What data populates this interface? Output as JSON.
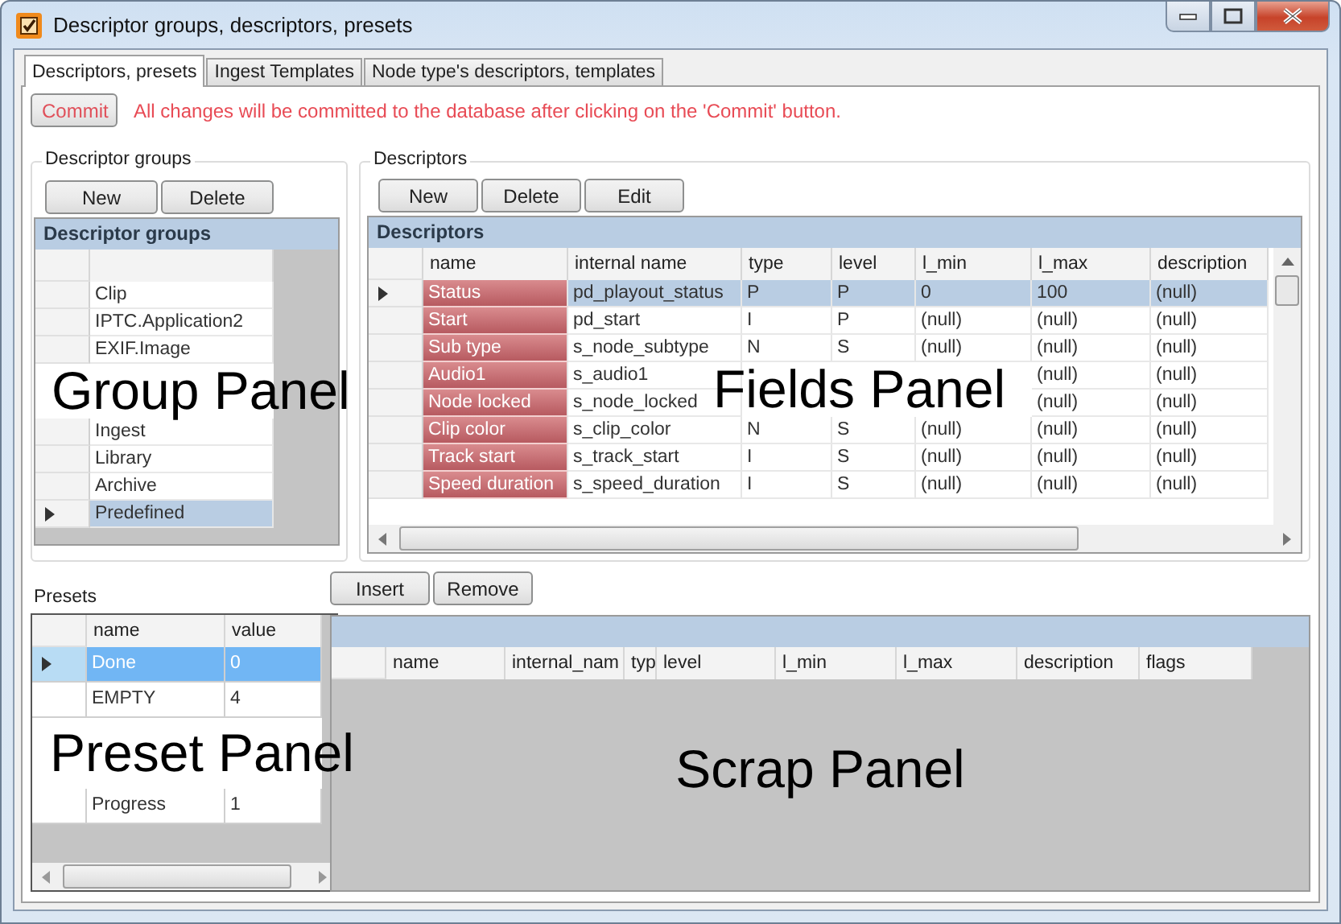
{
  "window": {
    "title": "Descriptor groups, descriptors, presets"
  },
  "tabs": [
    {
      "label": "Descriptors, presets",
      "selected": true
    },
    {
      "label": "Ingest Templates",
      "selected": false
    },
    {
      "label": "Node type's descriptors, templates",
      "selected": false
    }
  ],
  "commit_button": "Commit",
  "commit_note": "All changes will be committed to the database after clicking on the 'Commit' button.",
  "descriptor_groups": {
    "legend": "Descriptor groups",
    "buttons": [
      "New",
      "Delete"
    ],
    "grid_title": "Descriptor groups",
    "items": [
      {
        "name": "Clip",
        "selected": false
      },
      {
        "name": "IPTC.Application2",
        "selected": false
      },
      {
        "name": "EXIF.Image",
        "selected": false
      },
      {
        "selected": false
      },
      {
        "name": "Ingest",
        "selected": false
      },
      {
        "name": "Library",
        "selected": false
      },
      {
        "name": "Archive",
        "selected": false
      },
      {
        "name": "Predefined",
        "selected": true
      }
    ]
  },
  "descriptors": {
    "legend": "Descriptors",
    "buttons": [
      "New",
      "Delete",
      "Edit"
    ],
    "grid_title": "Descriptors",
    "columns": [
      "name",
      "internal name",
      "type",
      "level",
      "l_min",
      "l_max",
      "description"
    ],
    "rows": [
      {
        "name": "Status",
        "internal_name": "pd_playout_status",
        "type": "P",
        "level": "P",
        "l_min": "0",
        "l_max": "100",
        "description": "(null)",
        "selected": true
      },
      {
        "name": "Start",
        "internal_name": "pd_start",
        "type": "I",
        "level": "P",
        "l_min": "(null)",
        "l_max": "(null)",
        "description": "(null)",
        "selected": false
      },
      {
        "name": "Sub type",
        "internal_name": "s_node_subtype",
        "type": "N",
        "level": "S",
        "l_min": "(null)",
        "l_max": "(null)",
        "description": "(null)",
        "selected": false
      },
      {
        "name": "Audio1",
        "internal_name": "s_audio1",
        "l_max": "(null)",
        "description": "(null)",
        "selected": false
      },
      {
        "name": "Node locked",
        "internal_name": "s_node_locked",
        "l_max": "(null)",
        "description": "(null)",
        "selected": false
      },
      {
        "name": "Clip color",
        "internal_name": "s_clip_color",
        "type": "N",
        "level": "S",
        "l_min": "(null)",
        "l_max": "(null)",
        "description": "(null)",
        "selected": false
      },
      {
        "name": "Track start",
        "internal_name": "s_track_start",
        "type": "I",
        "level": "S",
        "l_min": "(null)",
        "l_max": "(null)",
        "description": "(null)",
        "selected": false
      },
      {
        "name": "Speed duration",
        "internal_name": "s_speed_duration",
        "type": "I",
        "level": "S",
        "l_min": "(null)",
        "l_max": "(null)",
        "description": "(null)",
        "selected": false
      }
    ]
  },
  "presets": {
    "legend": "Presets",
    "columns": [
      "name",
      "value"
    ],
    "rows": [
      {
        "name": "Done",
        "value": "0",
        "selected": true
      },
      {
        "name": "EMPTY",
        "value": "4",
        "selected": false
      },
      {
        "selected": false
      },
      {
        "selected": false
      },
      {
        "name": "Progress",
        "value": "1",
        "selected": false
      }
    ]
  },
  "scrap": {
    "buttons": [
      "Insert",
      "Remove"
    ],
    "columns": [
      "name",
      "internal_nam",
      "typ",
      "level",
      "l_min",
      "l_max",
      "description",
      "flags"
    ]
  },
  "overlay_labels": [
    "Group Panel",
    "Fields Panel",
    "Preset Panel",
    "Scrap Panel"
  ]
}
